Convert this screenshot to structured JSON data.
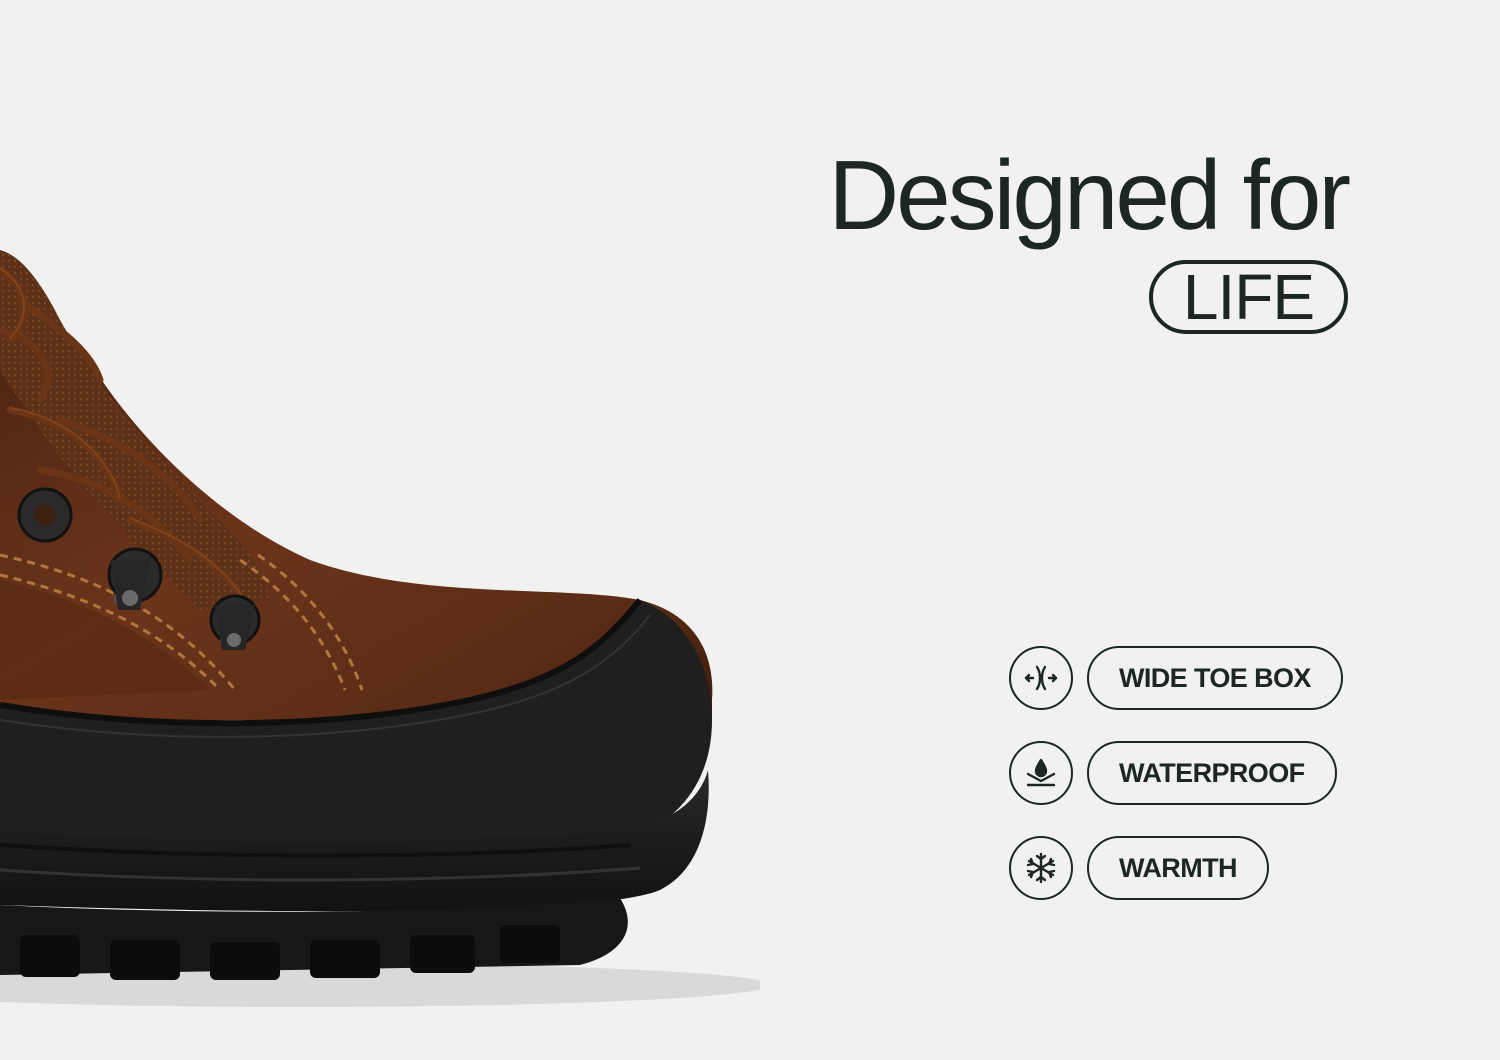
{
  "headline": {
    "line1": "Designed for",
    "pill": "LIFE"
  },
  "features": [
    {
      "icon": "wide-toe-box-icon",
      "label": "WIDE TOE BOX"
    },
    {
      "icon": "waterproof-icon",
      "label": "WATERPROOF"
    },
    {
      "icon": "snowflake-icon",
      "label": "WARMTH"
    }
  ],
  "colors": {
    "background": "#f1f1f0",
    "text": "#1c2624",
    "leather": "#5e2f18",
    "sole": "#1b1b1b"
  }
}
